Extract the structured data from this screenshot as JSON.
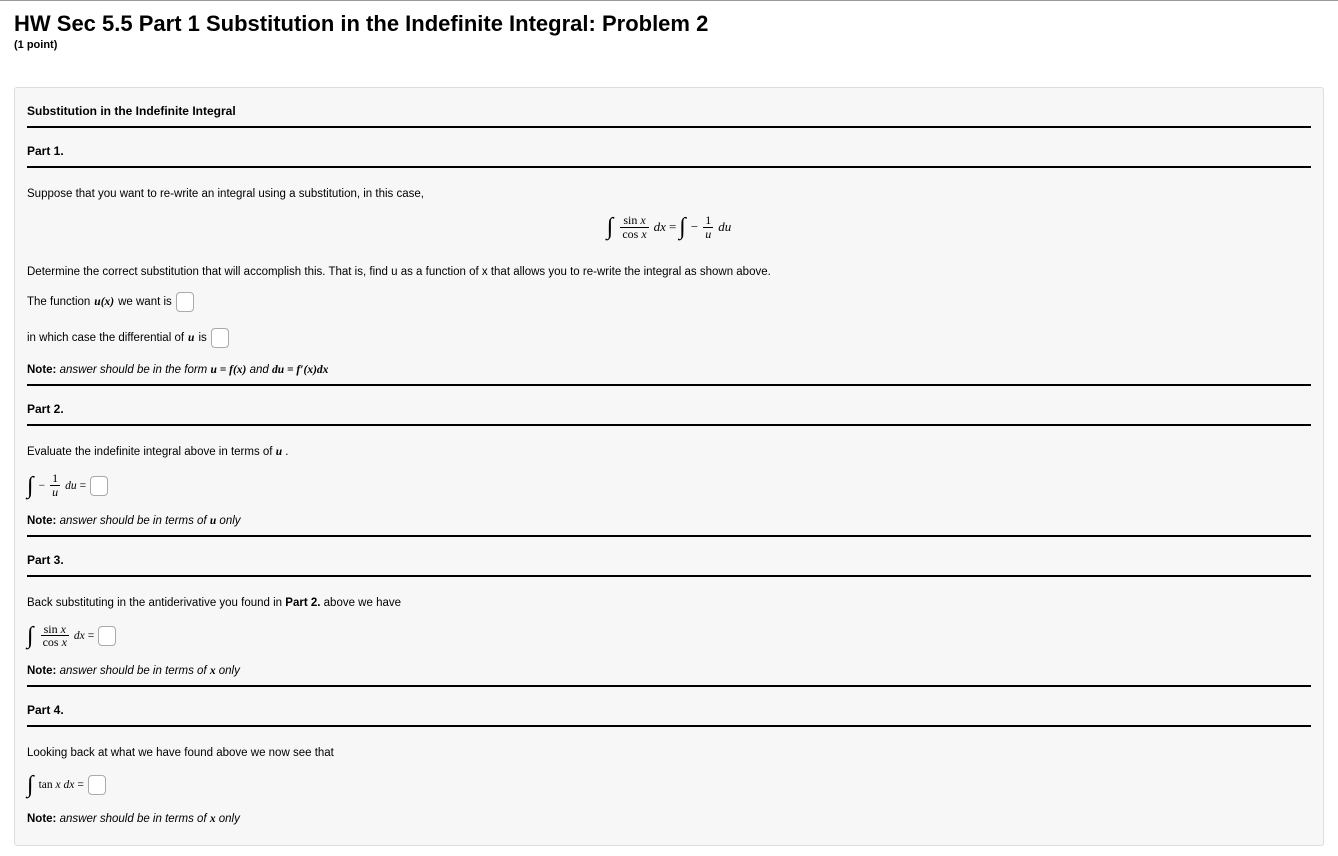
{
  "header": {
    "title": "HW Sec 5.5 Part 1 Substitution in the Indefinite Integral: Problem 2",
    "points": "(1 point)"
  },
  "problem": {
    "section_title": "Substitution in the Indefinite Integral",
    "part1": {
      "label": "Part 1.",
      "intro": "Suppose that you want to re-write an integral using a substitution, in this case,",
      "equation_text": "∫ (sin x / cos x) dx = ∫ −(1/u) du",
      "instruction": "Determine the correct substitution that will accomplish this. That is, find u as a function of x that allows you to re-write the integral as shown above.",
      "line_ux_before": "The function ",
      "line_ux_math": "u(x)",
      "line_ux_after": " we want is ",
      "line_du_before": "in which case the differential of ",
      "line_du_math": "u",
      "line_du_after": " is ",
      "note_label": "Note:",
      "note_body_a": " answer should be in the form ",
      "note_math1": "u = f(x)",
      "note_body_b": " and ",
      "note_math2": "du = f′(x)dx"
    },
    "part2": {
      "label": "Part 2.",
      "intro_a": "Evaluate the indefinite integral above in terms of ",
      "intro_math": "u",
      "intro_b": ".",
      "equation_text": "∫ −(1/u) du =",
      "note_label": "Note:",
      "note_body_a": " answer should be in terms of ",
      "note_math": "u",
      "note_body_b": " only"
    },
    "part3": {
      "label": "Part 3.",
      "intro_a": "Back substituting in the antiderivative you found in ",
      "intro_bold": "Part 2.",
      "intro_b": " above we have",
      "equation_text": "∫ (sin x / cos x) dx =",
      "note_label": "Note:",
      "note_body_a": " answer should be in terms of ",
      "note_math": "x",
      "note_body_b": " only"
    },
    "part4": {
      "label": "Part 4.",
      "intro": "Looking back at what we have found above we now see that",
      "equation_text": "∫ tan x dx =",
      "note_label": "Note:",
      "note_body_a": " answer should be in terms of ",
      "note_math": "x",
      "note_body_b": " only"
    }
  }
}
